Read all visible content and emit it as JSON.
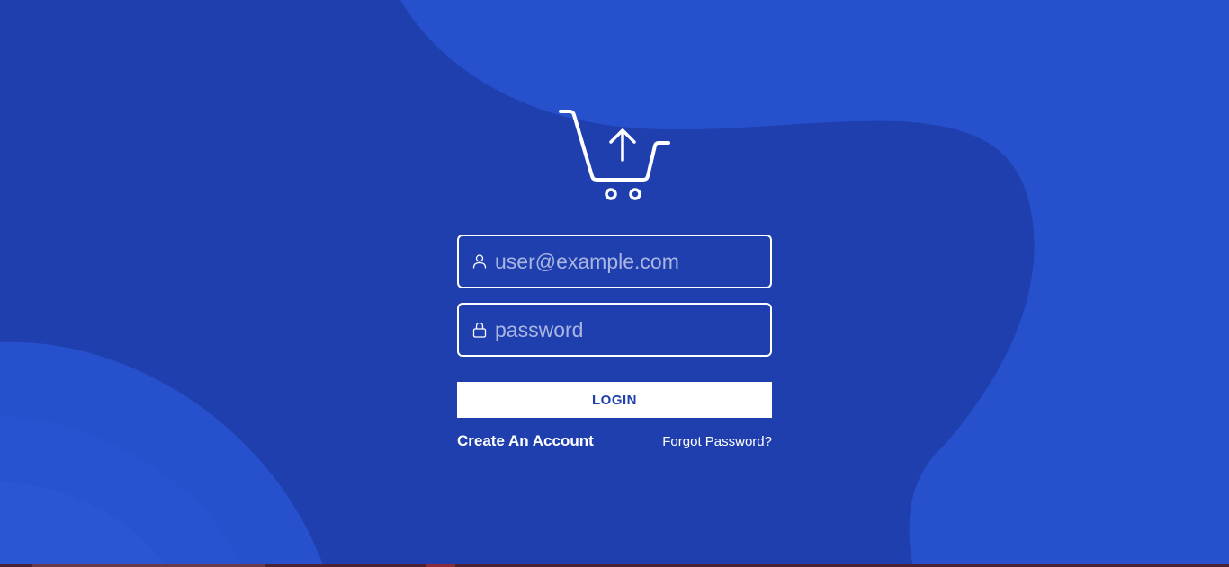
{
  "theme": {
    "background": "#1f3fae",
    "blob": "#2750cc",
    "accent": "#ffffff",
    "button_text": "#1f3fae",
    "placeholder": "#a9b6e3"
  },
  "logo": {
    "icon": "shopping-cart-upload-icon"
  },
  "form": {
    "email": {
      "icon": "user-icon",
      "placeholder": "user@example.com",
      "value": ""
    },
    "password": {
      "icon": "lock-icon",
      "placeholder": "password",
      "value": ""
    },
    "login_label": "LOGIN",
    "create_account_label": "Create An Account",
    "forgot_password_label": "Forgot Password?"
  }
}
